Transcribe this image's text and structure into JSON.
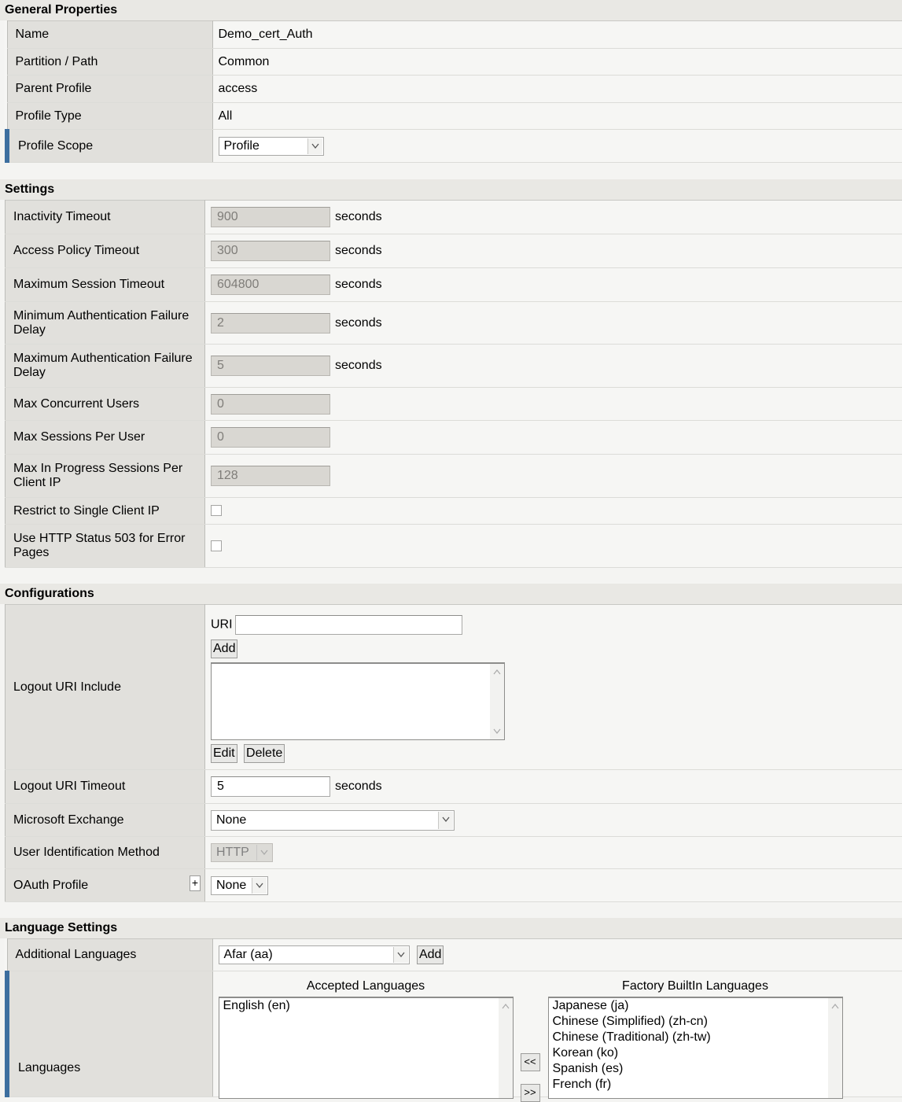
{
  "general": {
    "title": "General Properties",
    "name_label": "Name",
    "name_value": "Demo_cert_Auth",
    "partition_label": "Partition / Path",
    "partition_value": "Common",
    "parent_label": "Parent Profile",
    "parent_value": "access",
    "type_label": "Profile Type",
    "type_value": "All",
    "scope_label": "Profile Scope",
    "scope_value": "Profile"
  },
  "settings": {
    "title": "Settings",
    "unit": "seconds",
    "rows": [
      {
        "label": "Inactivity Timeout",
        "value": "900",
        "unit": "seconds"
      },
      {
        "label": "Access Policy Timeout",
        "value": "300",
        "unit": "seconds"
      },
      {
        "label": "Maximum Session Timeout",
        "value": "604800",
        "unit": "seconds"
      },
      {
        "label": "Minimum Authentication Failure Delay",
        "value": "2",
        "unit": "seconds"
      },
      {
        "label": "Maximum Authentication Failure Delay",
        "value": "5",
        "unit": "seconds"
      },
      {
        "label": "Max Concurrent Users",
        "value": "0"
      },
      {
        "label": "Max Sessions Per User",
        "value": "0"
      },
      {
        "label": "Max In Progress Sessions Per Client IP",
        "value": "128"
      }
    ],
    "restrict_label": "Restrict to Single Client IP",
    "http503_label": "Use HTTP Status 503 for Error Pages"
  },
  "configurations": {
    "title": "Configurations",
    "logout_include_label": "Logout URI Include",
    "uri_label": "URI",
    "uri_value": "",
    "add_label": "Add",
    "edit_label": "Edit",
    "delete_label": "Delete",
    "logout_timeout_label": "Logout URI Timeout",
    "logout_timeout_value": "5",
    "logout_timeout_unit": "seconds",
    "exchange_label": "Microsoft Exchange",
    "exchange_value": "None",
    "user_id_label": "User Identification Method",
    "user_id_value": "HTTP",
    "oauth_label": "OAuth Profile",
    "oauth_plus": "+",
    "oauth_value": "None"
  },
  "language": {
    "title": "Language Settings",
    "additional_label": "Additional Languages",
    "additional_value": "Afar (aa)",
    "add_label": "Add",
    "languages_label": "Languages",
    "accepted_header": "Accepted Languages",
    "accepted": [
      "English (en)"
    ],
    "factory_header": "Factory BuiltIn Languages",
    "factory": [
      "Japanese (ja)",
      "Chinese (Simplified) (zh-cn)",
      "Chinese (Traditional) (zh-tw)",
      "Korean (ko)",
      "Spanish (es)",
      "French (fr)"
    ],
    "move_left": "<<",
    "move_right": ">>"
  },
  "colors": {
    "accent_marker": "#3c6e9f",
    "label_bg": "#e1e0dc",
    "disabled_input": "#d9d7d2"
  },
  "icons": [
    "chevron-down-icon",
    "scroll-up-icon",
    "scroll-down-icon",
    "plus-icon"
  ]
}
